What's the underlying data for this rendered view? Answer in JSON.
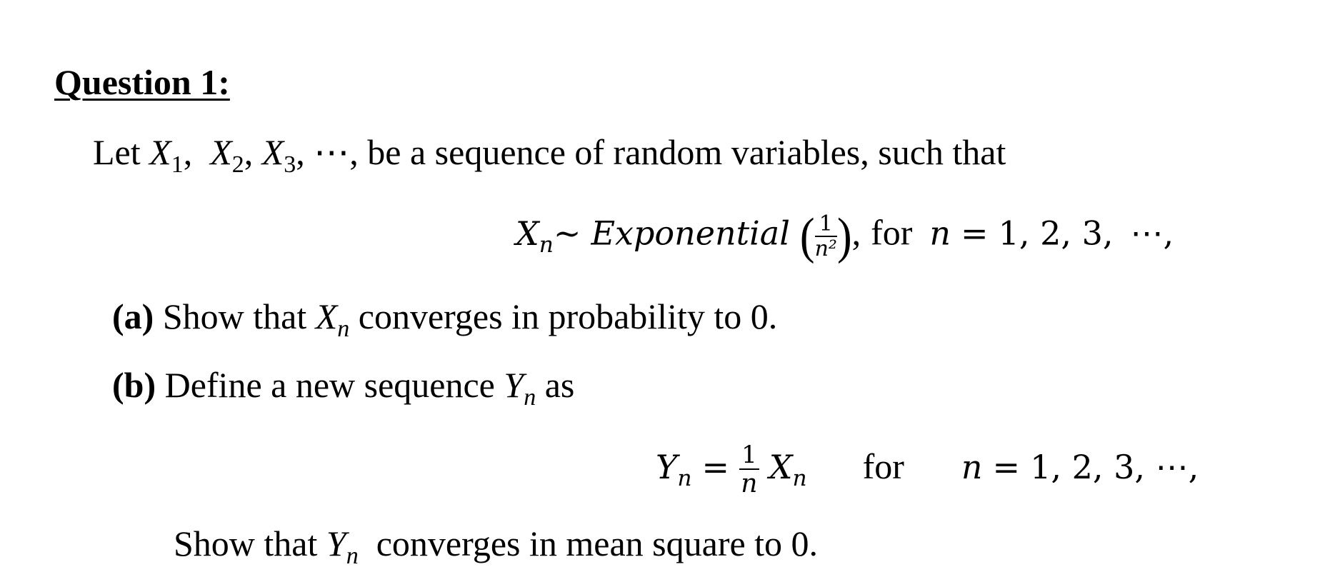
{
  "question": {
    "heading": "Question 1:",
    "intro": {
      "prefix": "Let ",
      "vars": [
        {
          "base": "X",
          "sub": "1",
          "sep": ",  "
        },
        {
          "base": "X",
          "sub": "2",
          "sep": ", "
        },
        {
          "base": "X",
          "sub": "3",
          "sep": ", "
        }
      ],
      "ellipsis": "⋯",
      "suffix": ", be a sequence of random variables, such that"
    },
    "distribution": {
      "lhs_base": "X",
      "lhs_sub": "n",
      "tilde": "~",
      "dist_name": "Exponential",
      "param_num": "1",
      "param_den": "n²",
      "after_paren": ",",
      "for_word": "for",
      "range_var": "n",
      "range_eq": "=",
      "range_values": "1, 2, 3,",
      "range_ellipsis": "⋯,"
    },
    "part_a": {
      "label": "(a)",
      "text_before": " Show that ",
      "var_base": "X",
      "var_sub": "n",
      "text_after": " converges in probability to 0."
    },
    "part_b": {
      "label": "(b)",
      "text_before": " Define a new sequence ",
      "var_base": "Y",
      "var_sub": "n",
      "text_after": " as"
    },
    "definition": {
      "lhs_base": "Y",
      "lhs_sub": "n",
      "eq": "=",
      "frac_num": "1",
      "frac_den": "n",
      "rhs_base": "X",
      "rhs_sub": "n",
      "for_word": "for",
      "range_var": "n",
      "range_eq": "=",
      "range_values": "1, 2, 3, ⋯,"
    },
    "part_b_task": {
      "text_before": "Show that ",
      "var_base": "Y",
      "var_sub": "n",
      "text_after": "  converges in mean square to 0."
    }
  }
}
